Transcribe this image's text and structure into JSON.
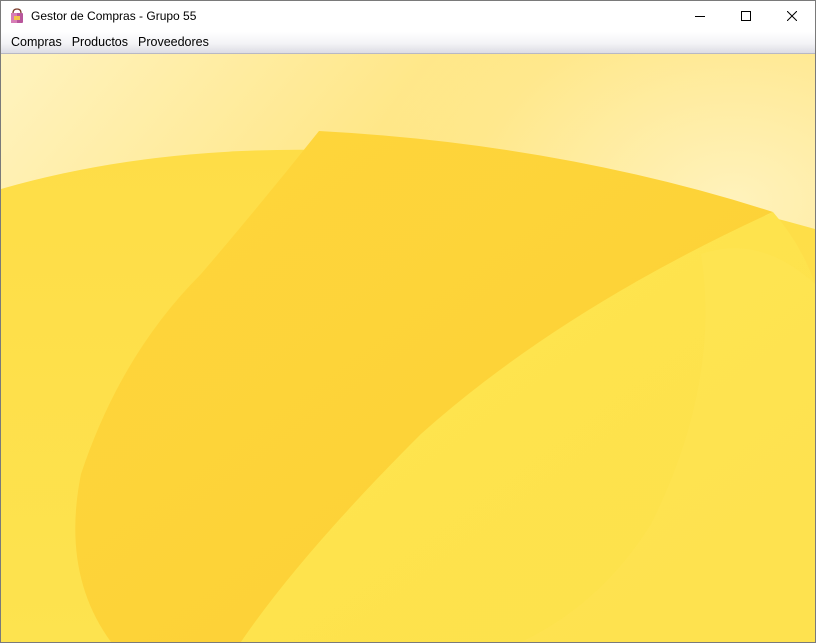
{
  "window": {
    "title": "Gestor de Compras - Grupo 55",
    "app_icon": "shopping-bag-icon",
    "controls": {
      "minimize_icon": "minimize-icon",
      "maximize_icon": "maximize-icon",
      "close_icon": "close-icon"
    }
  },
  "menubar": {
    "items": [
      {
        "label": "Compras"
      },
      {
        "label": "Productos"
      },
      {
        "label": "Proveedores"
      }
    ]
  },
  "desktop": {
    "background": "yellow-abstract-wallpaper",
    "colors": {
      "base": "#fde24a",
      "light": "#fff3c0",
      "mid": "#fed63c",
      "dark": "#fccf32"
    }
  }
}
